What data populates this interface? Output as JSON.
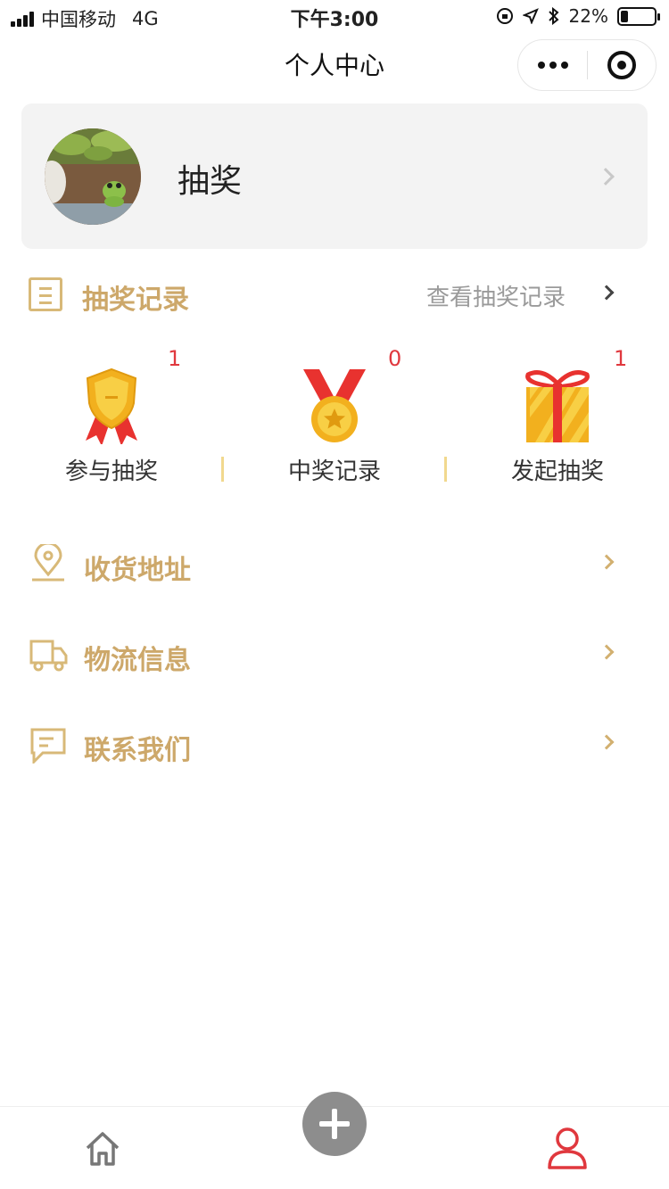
{
  "status_bar": {
    "carrier": "中国移动",
    "network": "4G",
    "time": "下午3:00",
    "battery": "22%",
    "battery_level": 0.22
  },
  "nav": {
    "title": "个人中心",
    "more_icon": "more-dots-icon",
    "close_icon": "target-circle-icon"
  },
  "profile": {
    "name": "抽奖",
    "avatar_icon": "frog-avatar"
  },
  "records_section": {
    "title": "抽奖记录",
    "link": "查看抽奖记录",
    "icon": "list-document-icon"
  },
  "stats": [
    {
      "label": "参与抽奖",
      "count": "1",
      "icon": "badge-ribbon-icon"
    },
    {
      "label": "中奖记录",
      "count": "0",
      "icon": "medal-icon"
    },
    {
      "label": "发起抽奖",
      "count": "1",
      "icon": "gift-icon"
    }
  ],
  "menu": [
    {
      "label": "收货地址",
      "icon": "location-pin-icon"
    },
    {
      "label": "物流信息",
      "icon": "truck-icon"
    },
    {
      "label": "联系我们",
      "icon": "message-icon"
    }
  ],
  "tabbar": {
    "home_icon": "home-icon",
    "add_icon": "plus-icon",
    "user_icon": "user-icon"
  },
  "colors": {
    "accent_gold": "#cda86a",
    "badge_red": "#e0383e",
    "active_tab": "#e0383e"
  }
}
